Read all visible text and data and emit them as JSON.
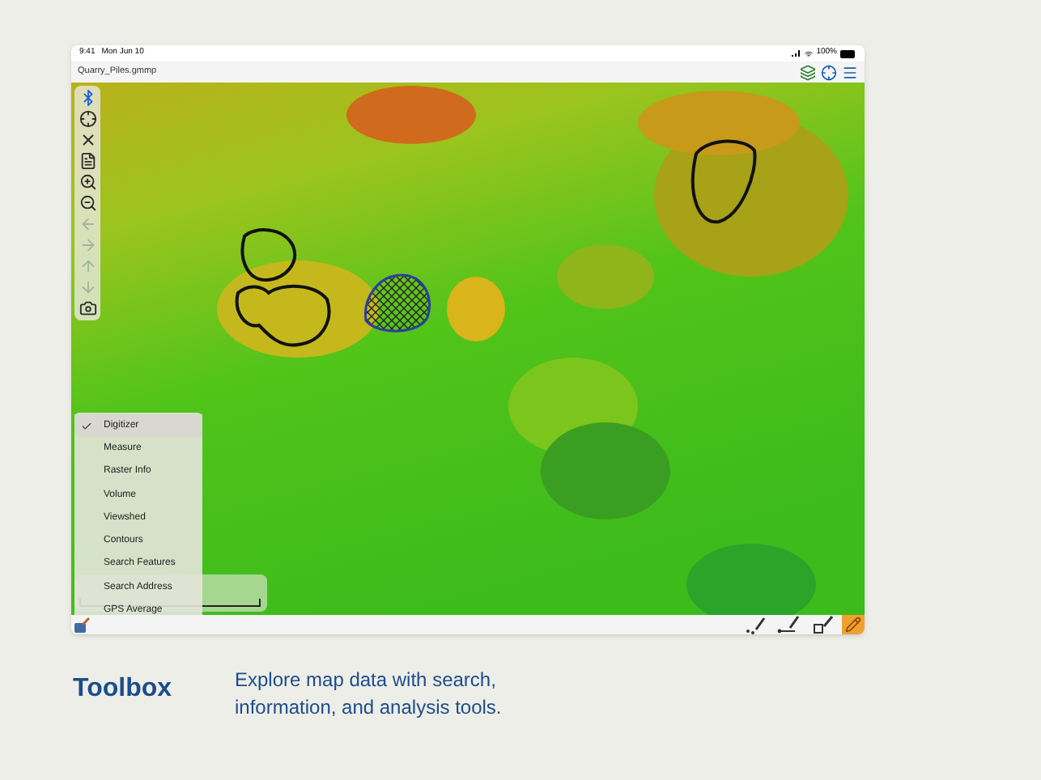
{
  "status_bar": {
    "time": "9:41",
    "date": "Mon Jun 10",
    "battery": "100%"
  },
  "title_bar": {
    "title": "Quarry_Piles.gmmp"
  },
  "toolbar": [
    {
      "kind": "bluetooth",
      "active": true,
      "disabled": false
    },
    {
      "kind": "target",
      "active": false,
      "disabled": false
    },
    {
      "kind": "cross",
      "active": false,
      "disabled": false
    },
    {
      "kind": "file",
      "active": false,
      "disabled": false
    },
    {
      "kind": "zoom_in",
      "active": false,
      "disabled": false
    },
    {
      "kind": "zoom_out",
      "active": false,
      "disabled": false
    },
    {
      "kind": "left",
      "active": false,
      "disabled": true
    },
    {
      "kind": "right",
      "active": false,
      "disabled": true
    },
    {
      "kind": "up",
      "active": false,
      "disabled": true
    },
    {
      "kind": "down",
      "active": false,
      "disabled": true
    },
    {
      "kind": "camera",
      "active": false,
      "disabled": false
    }
  ],
  "toolbox_menu": [
    {
      "label": "Digitizer",
      "selected": true
    },
    {
      "label": "Measure",
      "selected": false
    },
    {
      "label": "Raster Info",
      "selected": false
    },
    {
      "label": "Volume",
      "selected": false
    },
    {
      "label": "Viewshed",
      "selected": false
    },
    {
      "label": "Contours",
      "selected": false
    },
    {
      "label": "Search Features",
      "selected": false
    },
    {
      "label": "Search Address",
      "selected": false
    },
    {
      "label": "GPS Average",
      "selected": false
    }
  ],
  "bottom_tools": [
    {
      "kind": "point",
      "selected": false
    },
    {
      "kind": "line",
      "selected": false
    },
    {
      "kind": "area",
      "selected": false
    },
    {
      "kind": "edit",
      "selected": true
    }
  ],
  "caption": {
    "title": "Toolbox",
    "text": "Explore map data with search, information, and analysis tools."
  }
}
